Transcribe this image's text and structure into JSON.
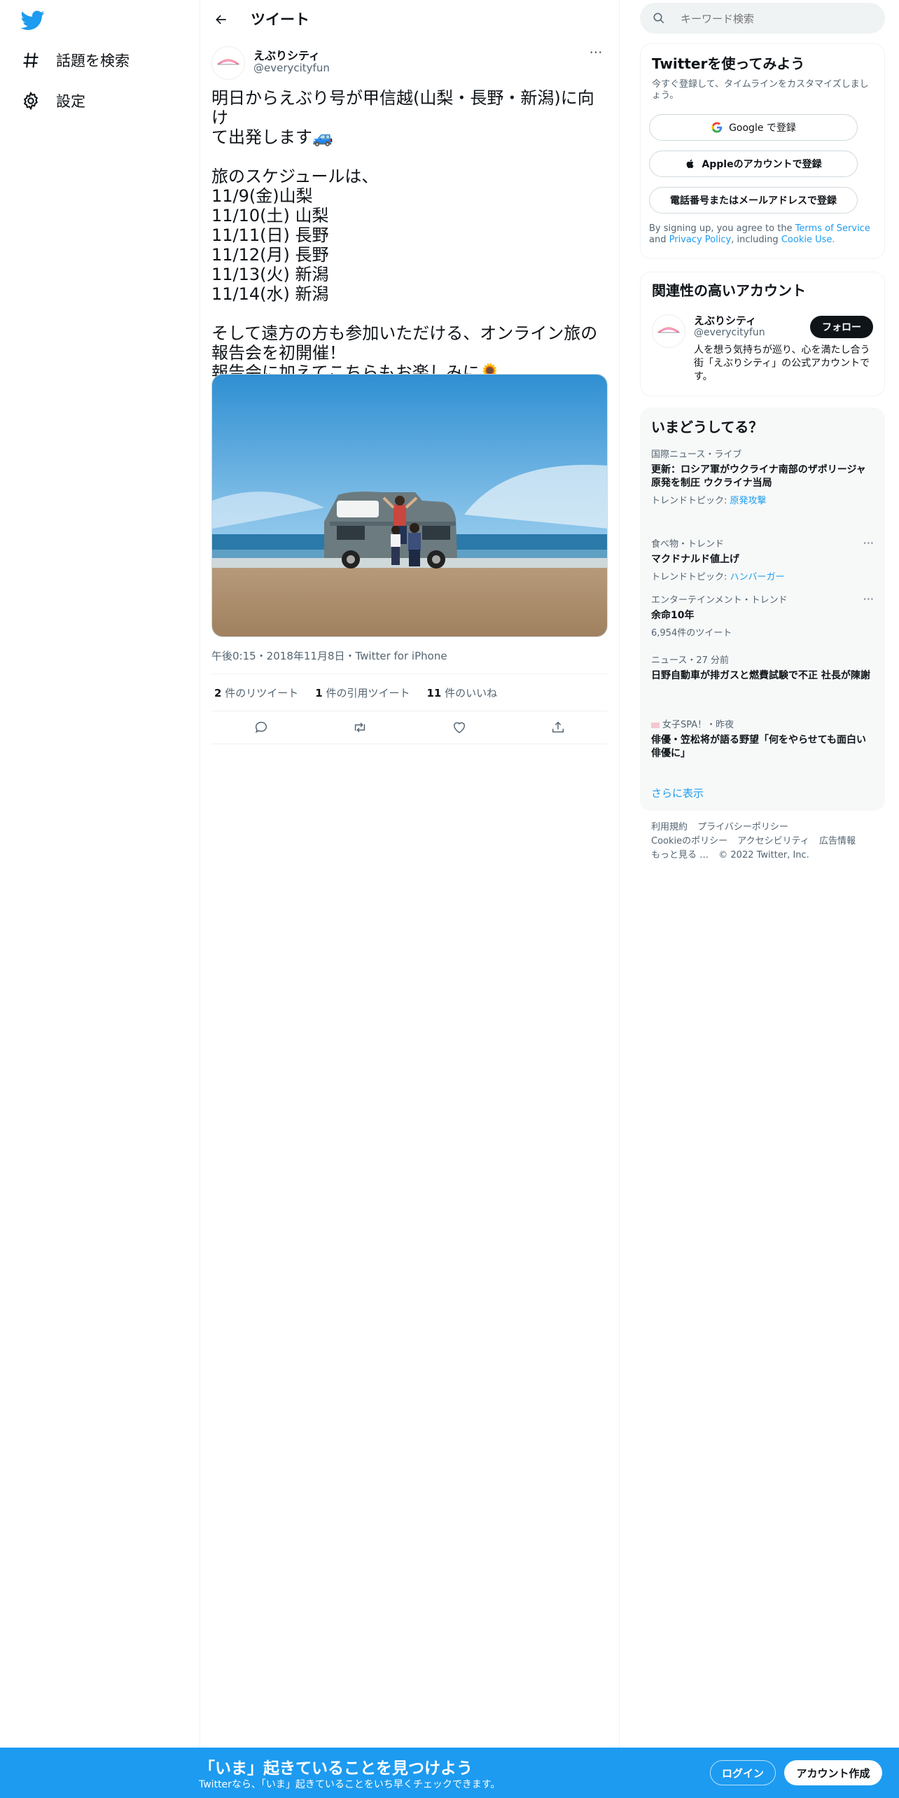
{
  "nav": {
    "explore_label": "話題を検索",
    "settings_label": "設定"
  },
  "header": {
    "title": "ツイート"
  },
  "tweet": {
    "author_name": "えぶりシティ",
    "author_handle": "@everycityfun",
    "avatar_text": "えぶりシティ",
    "lines": [
      "明日からえぶり号が甲信越(山梨・長野・新潟)に向け",
      "て出発します🚙",
      "",
      "旅のスケジュールは、",
      "11/9(金)山梨",
      "11/10(土) 山梨",
      "11/11(日) 長野",
      "11/12(月) 長野",
      "11/13(火) 新潟",
      "11/14(水) 新潟",
      "",
      "そして遠方の方も参加いただける、オンライン旅の",
      "報告会を初開催！",
      "報告会に加えてこちらもお楽しみに🌻"
    ],
    "meta": "午後0:15・2018年11月8日・Twitter for iPhone",
    "retweets_count": "2",
    "retweets_label": "件のリツイート",
    "quotes_count": "1",
    "quotes_label": "件の引用ツイート",
    "likes_count": "11",
    "likes_label": "件のいいね"
  },
  "search": {
    "placeholder": "キーワード検索"
  },
  "signup": {
    "title": "Twitterを使ってみよう",
    "subtitle": "今すぐ登録して、タイムラインをカスタマイズしましょう。",
    "google_label": "Google で登録",
    "apple_label": "Appleのアカウントで登録",
    "phone_label": "電話番号またはメールアドレスで登録",
    "terms_prefix": "By signing up, you agree to the",
    "terms_link": "Terms of Service",
    "terms_and": "and",
    "privacy_link": "Privacy Policy",
    "terms_including": ", including",
    "cookie_link": "Cookie Use."
  },
  "related": {
    "title": "関連性の高いアカウント",
    "name": "えぶりシティ",
    "handle": "@everycityfun",
    "follow_label": "フォロー",
    "bio": "人を想う気持ちが巡り、心を満たし合う街「えぶりシティ」の公式アカウントです。"
  },
  "trends": {
    "title": "いまどうしてる？",
    "items": [
      {
        "category": "国際ニュース・ライブ",
        "title": "更新：ロシア軍がウクライナ南部のザポリージャ原発を制圧 ウクライナ当局",
        "sub_prefix": "トレンドトピック:",
        "sub_link": "原発攻撃"
      },
      {
        "category": "食べ物・トレンド",
        "title": "マクドナルド値上げ",
        "sub_prefix": "トレンドトピック:",
        "sub_link": "ハンバーガー"
      },
      {
        "category": "エンターテインメント・トレンド",
        "title": "余命10年",
        "sub": "6,954件のツイート"
      },
      {
        "category": "ニュース・27 分前",
        "title": "日野自動車が排ガスと燃費試験で不正 社長が陳謝"
      },
      {
        "category": "女子SPA！・昨夜",
        "title": "俳優・笠松将が語る野望「何をやらせても面白い俳優に」"
      }
    ],
    "show_more": "さらに表示"
  },
  "footer": {
    "links": [
      "利用規約",
      "プライバシーポリシー",
      "Cookieのポリシー",
      "アクセシビリティ",
      "広告情報",
      "もっと見る …"
    ],
    "copyright": "© 2022 Twitter, Inc."
  },
  "bottom": {
    "title": "「いま」起きていることを見つけよう",
    "subtitle": "Twitterなら、「いま」起きていることをいち早くチェックできます。",
    "login_label": "ログイン",
    "signup_label": "アカウント作成"
  },
  "colors": {
    "accent": "#1d9bf0",
    "text": "#0f1419",
    "muted": "#536471"
  }
}
